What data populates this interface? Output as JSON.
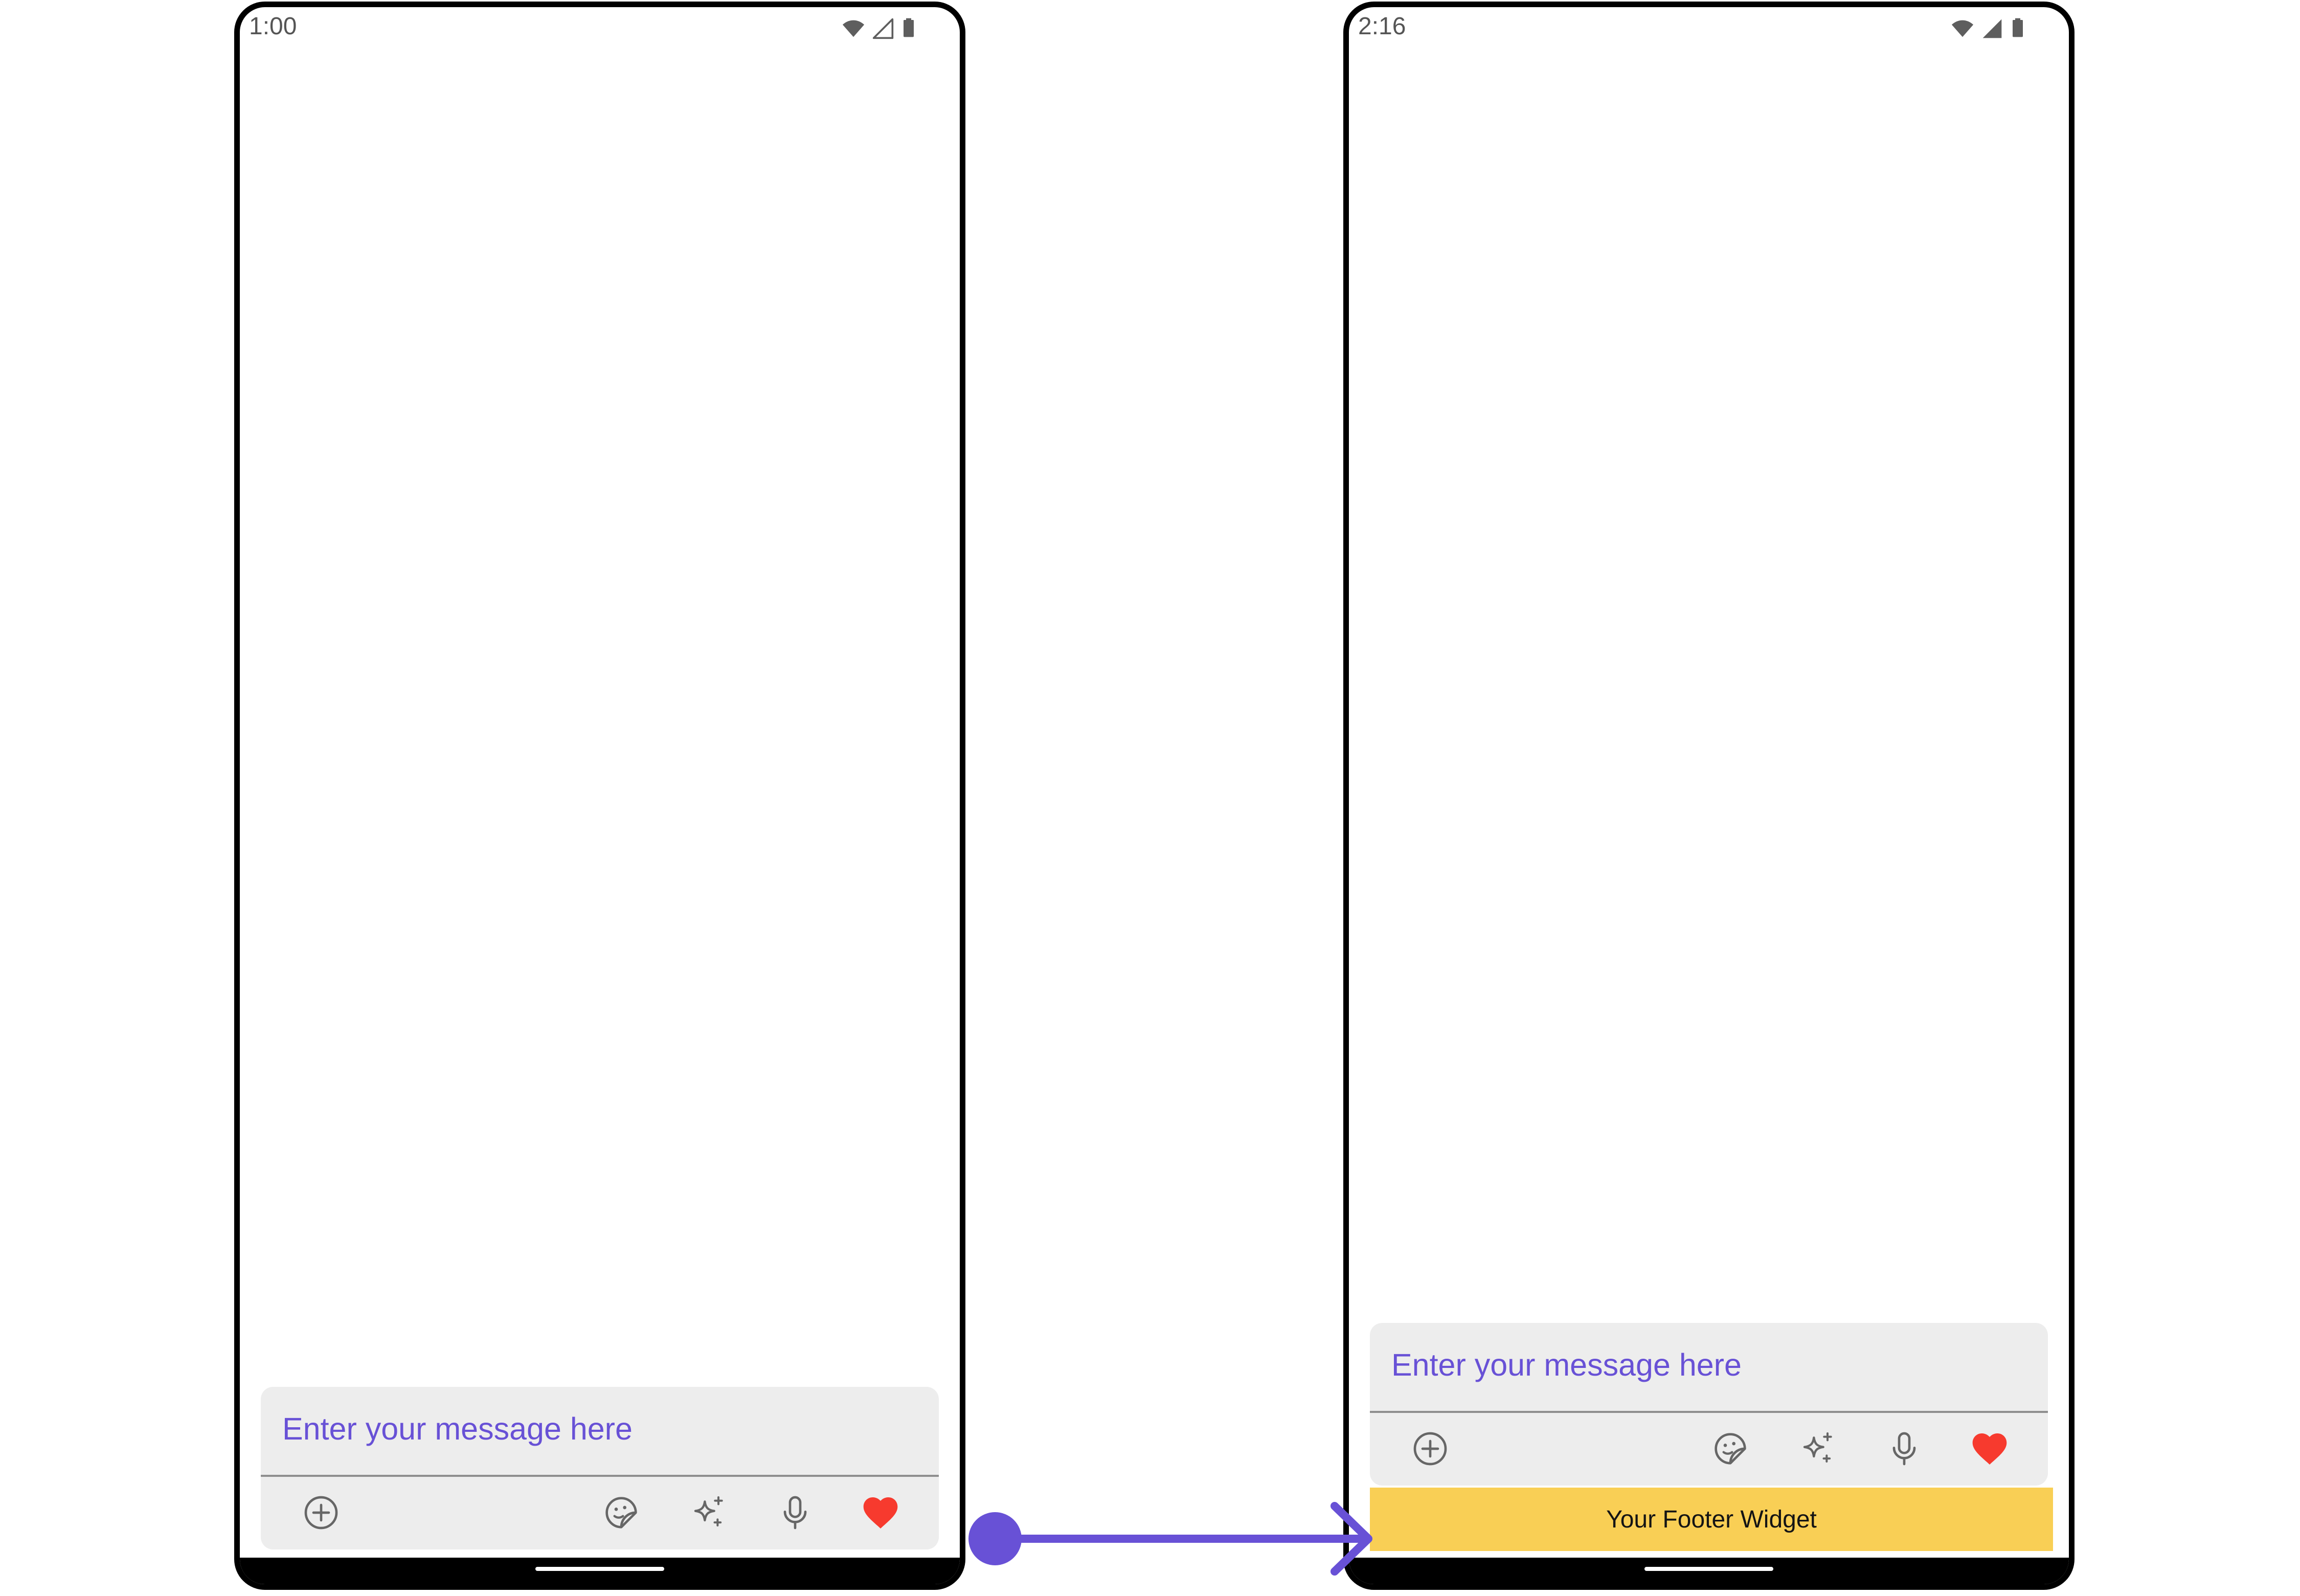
{
  "left_phone": {
    "status_time": "1:00",
    "composer": {
      "placeholder": "Enter your message here"
    }
  },
  "right_phone": {
    "status_time": "2:16",
    "composer": {
      "placeholder": "Enter your message here"
    },
    "footer_widget_label": "Your Footer Widget"
  },
  "icons": {
    "attachment": "plus-circle-icon",
    "sticker": "sticker-icon",
    "ai": "sparkles-icon",
    "voice": "microphone-icon",
    "send": "heart-icon"
  },
  "colors": {
    "placeholder": "#6851d6",
    "composer_bg": "#ededed",
    "heart": "#f73a2e",
    "footer_bg": "#f9cf55",
    "arrow": "#6851d6"
  }
}
